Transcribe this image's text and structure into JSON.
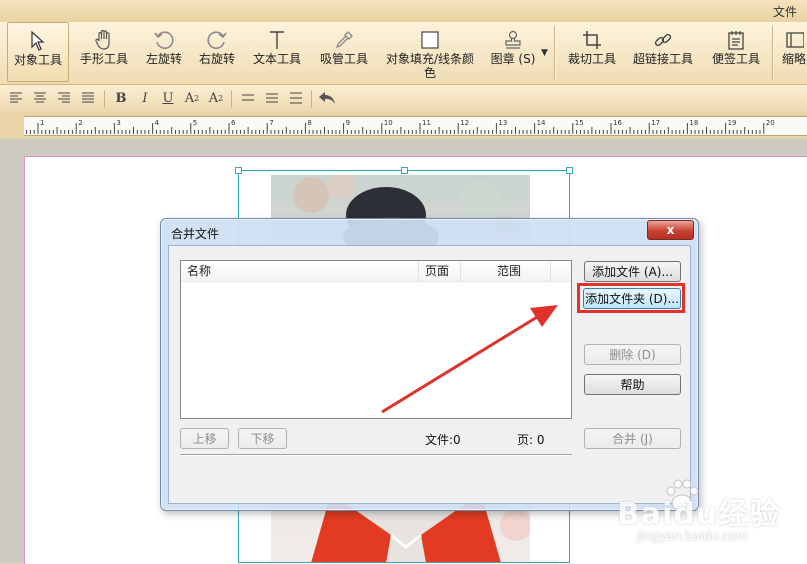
{
  "menu": {
    "file": "文件"
  },
  "ribbon": {
    "tools": [
      {
        "label": "对象工具",
        "icon": "cursor-arrow-icon"
      },
      {
        "label": "手形工具",
        "icon": "hand-icon"
      },
      {
        "label": "左旋转",
        "icon": "rotate-left-icon"
      },
      {
        "label": "右旋转",
        "icon": "rotate-right-icon"
      },
      {
        "label": "文本工具",
        "icon": "text-t-icon"
      },
      {
        "label": "吸管工具",
        "icon": "eyedropper-icon"
      },
      {
        "label": "对象填充/线条颜色",
        "icon": "fill-color-icon"
      },
      {
        "label": "图章 (S)",
        "icon": "stamp-icon"
      },
      {
        "label": "裁切工具",
        "icon": "crop-icon"
      },
      {
        "label": "超链接工具",
        "icon": "link-icon"
      },
      {
        "label": "便签工具",
        "icon": "note-icon"
      },
      {
        "label": "缩略",
        "icon": "thumbnail-icon"
      }
    ]
  },
  "format": {
    "bold": "B",
    "italic": "I",
    "underline": "U",
    "superscript": "A",
    "superscript_mark": "2",
    "subscript": "A",
    "subscript_mark": "2"
  },
  "ruler": {
    "labels": [
      "1",
      "2",
      "3",
      "4",
      "5",
      "6",
      "7",
      "8",
      "9",
      "10",
      "11",
      "12",
      "13",
      "14",
      "15",
      "16",
      "17",
      "18",
      "19",
      "20"
    ]
  },
  "dialog": {
    "title": "合并文件",
    "close": "x",
    "columns": [
      "名称",
      "页面",
      "范围"
    ],
    "buttons": {
      "add_file": "添加文件 (A)...",
      "add_folder": "添加文件夹 (D)...",
      "delete": "删除 (D)",
      "help": "帮助",
      "merge": "合并 (J)",
      "move_up": "上移",
      "move_down": "下移"
    },
    "status": {
      "files": "文件:0",
      "pages": "页: 0"
    }
  },
  "watermark": {
    "brand": "Baidu经验",
    "url": "jingyan.baidu.com"
  },
  "colors": {
    "highlight": "#e0312b",
    "arrow": "#e0312b",
    "selection": "#3aa7b6",
    "page_margin": "#e38fd6"
  }
}
